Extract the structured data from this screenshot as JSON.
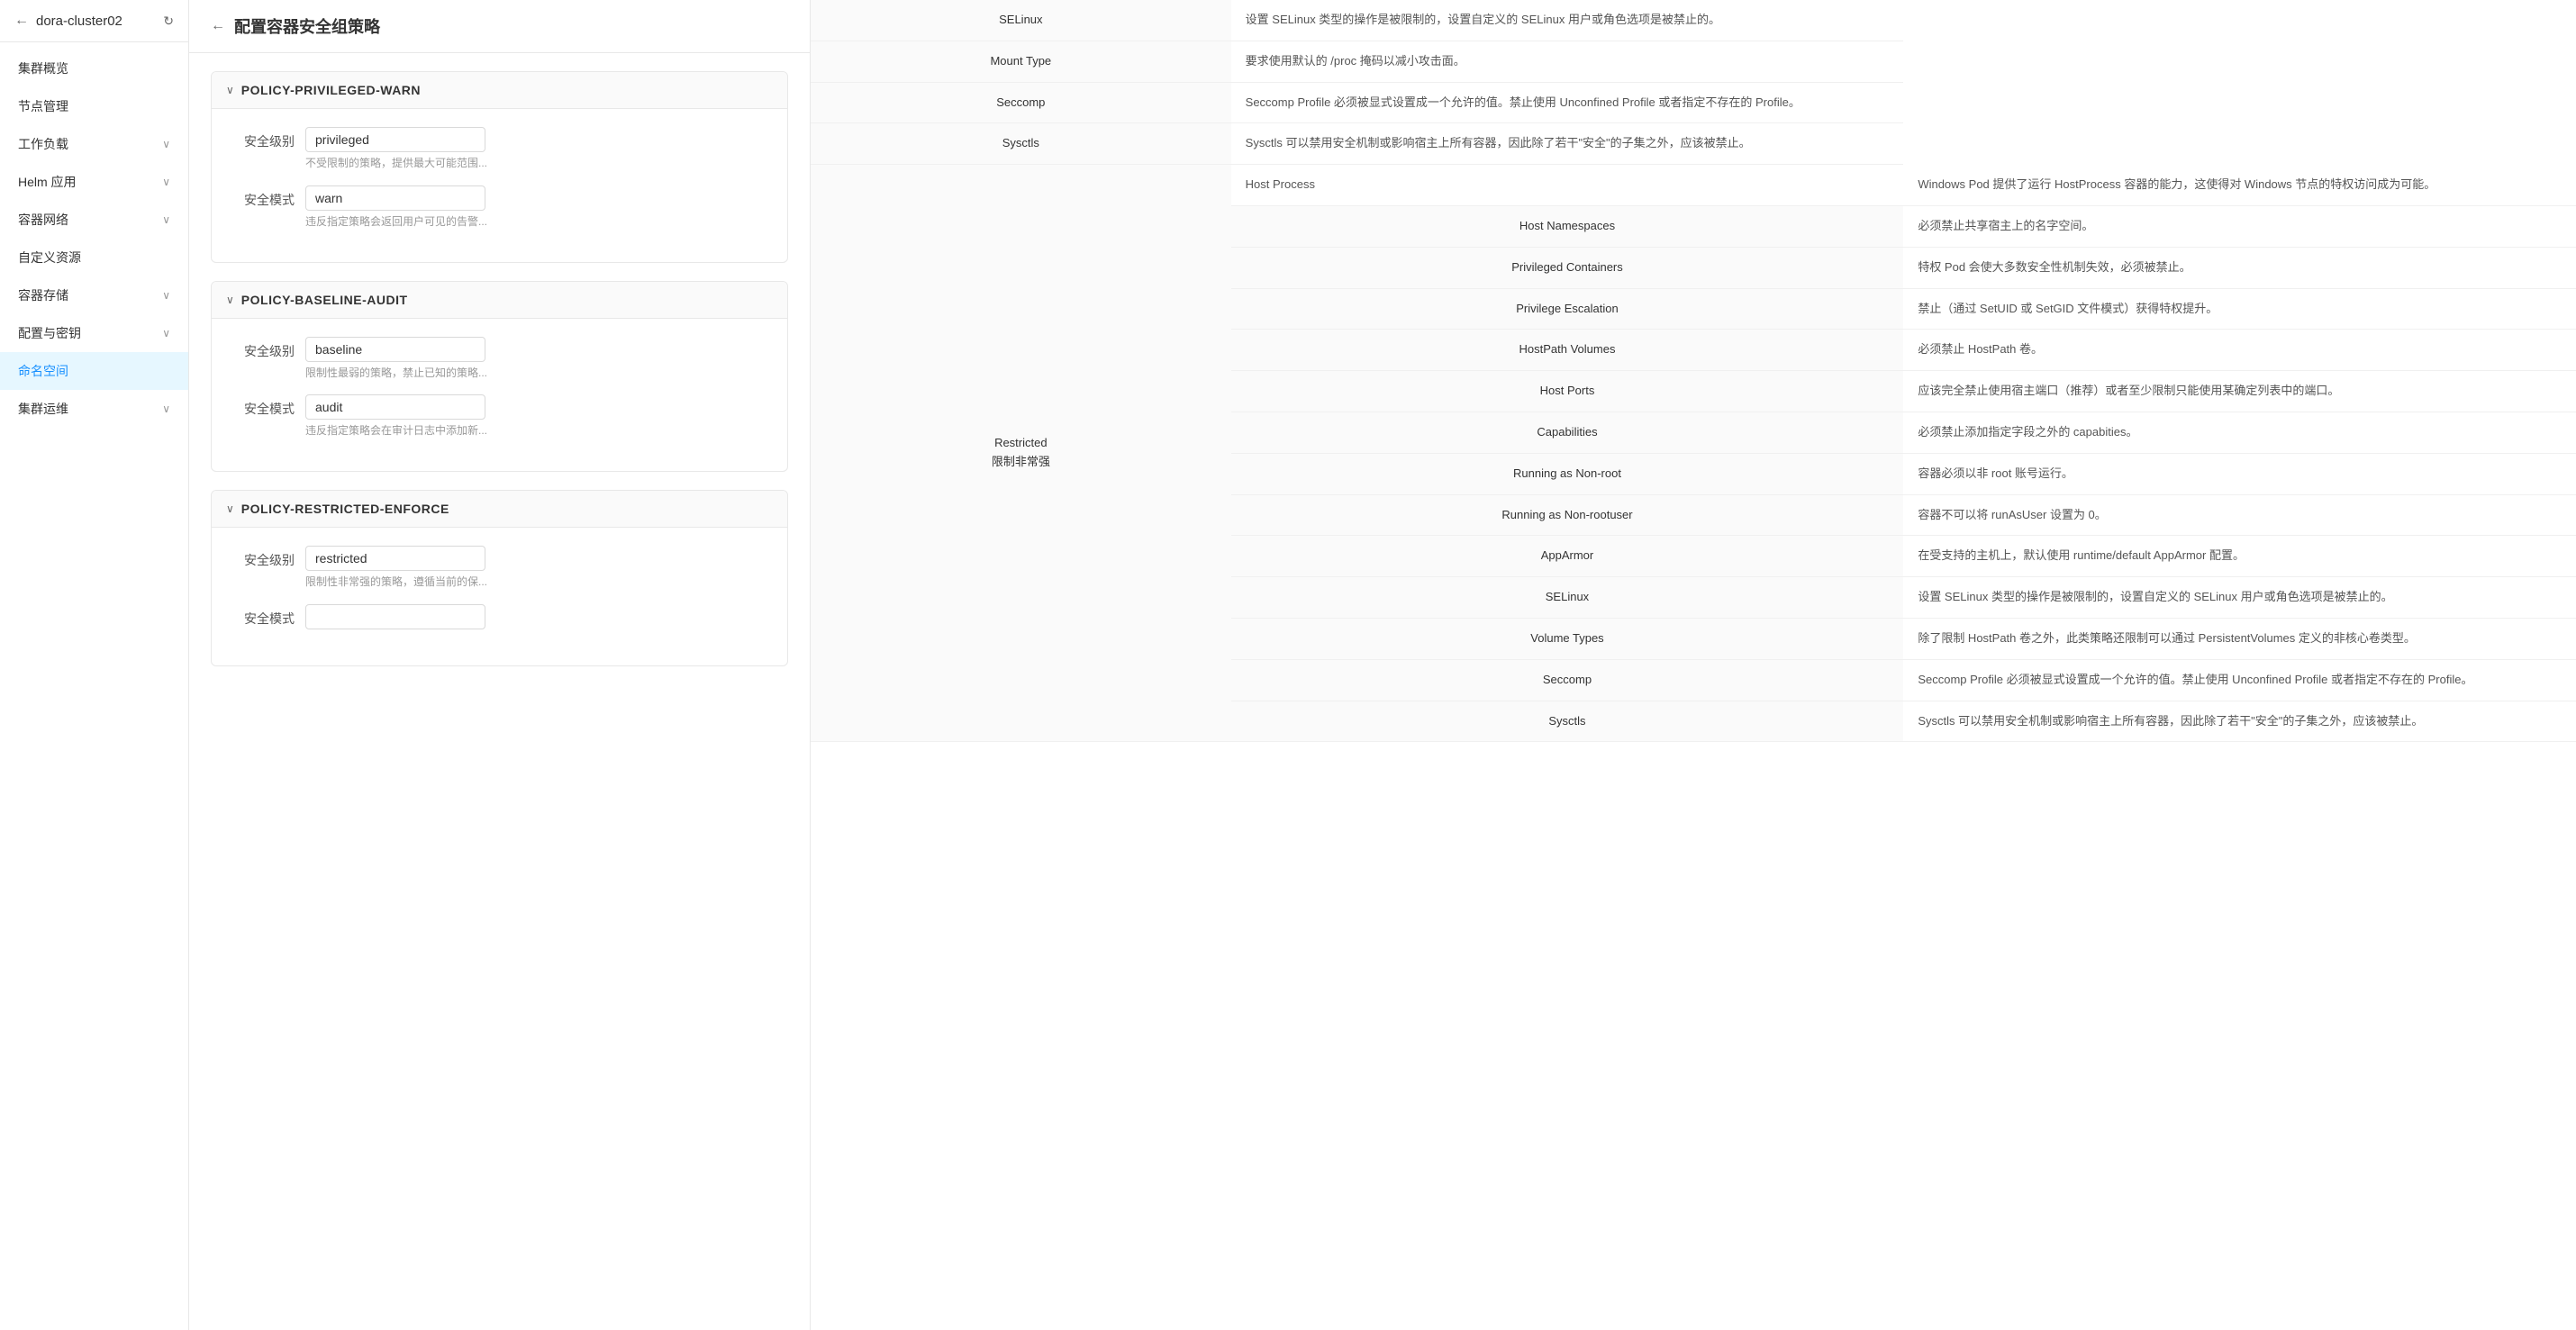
{
  "sidebar": {
    "cluster_name": "dora-cluster02",
    "nav_items": [
      {
        "id": "overview",
        "label": "集群概览",
        "has_children": false,
        "active": false
      },
      {
        "id": "nodes",
        "label": "节点管理",
        "has_children": false,
        "active": false
      },
      {
        "id": "workloads",
        "label": "工作负载",
        "has_children": true,
        "active": false
      },
      {
        "id": "helm",
        "label": "Helm 应用",
        "has_children": true,
        "active": false
      },
      {
        "id": "network",
        "label": "容器网络",
        "has_children": true,
        "active": false
      },
      {
        "id": "custom",
        "label": "自定义资源",
        "has_children": false,
        "active": false
      },
      {
        "id": "storage",
        "label": "容器存储",
        "has_children": true,
        "active": false
      },
      {
        "id": "config",
        "label": "配置与密钥",
        "has_children": true,
        "active": false
      },
      {
        "id": "namespace",
        "label": "命名空间",
        "has_children": false,
        "active": true
      },
      {
        "id": "ops",
        "label": "集群运维",
        "has_children": true,
        "active": false
      }
    ]
  },
  "left_panel": {
    "title": "配置容器安全组策略",
    "policies": [
      {
        "id": "privileged-warn",
        "name": "POLICY-PRIVILEGED-WARN",
        "security_level_label": "安全级别",
        "security_level_value": "privileged",
        "security_level_hint": "不受限制的策略，提供最大可能范围...",
        "security_mode_label": "安全模式",
        "security_mode_value": "warn",
        "security_mode_hint": "违反指定策略会返回用户可见的告警..."
      },
      {
        "id": "baseline-audit",
        "name": "POLICY-BASELINE-AUDIT",
        "security_level_label": "安全级别",
        "security_level_value": "baseline",
        "security_level_hint": "限制性最弱的策略，禁止已知的策略...",
        "security_mode_label": "安全模式",
        "security_mode_value": "audit",
        "security_mode_hint": "违反指定策略会在审计日志中添加新..."
      },
      {
        "id": "restricted-enforce",
        "name": "POLICY-RESTRICTED-ENFORCE",
        "security_level_label": "安全级别",
        "security_level_value": "restricted",
        "security_level_hint": "限制性非常强的策略，遵循当前的保...",
        "security_mode_label": "安全模式",
        "security_mode_value": "",
        "security_mode_hint": ""
      }
    ]
  },
  "right_panel": {
    "rows": [
      {
        "category": "",
        "field": "SELinux",
        "description": "设置 SELinux 类型的操作是被限制的，设置自定义的 SELinux 用户或角色选项是被禁止的。"
      },
      {
        "category": "",
        "field": "Mount Type",
        "description": "要求使用默认的 /proc 掩码以减小攻击面。"
      },
      {
        "category": "",
        "field": "Seccomp",
        "description": "Seccomp Profile 必须被显式设置成一个允许的值。禁止使用 Unconfined Profile 或者指定不存在的 Profile。"
      },
      {
        "category": "",
        "field": "Sysctls",
        "description": "Sysctls 可以禁用安全机制或影响宿主上所有容器，因此除了若干\"安全\"的子集之外，应该被禁止。"
      },
      {
        "category": "Restricted\n限制非常强",
        "field": "Host Process",
        "description": "Windows Pod 提供了运行 HostProcess 容器的能力，这使得对 Windows 节点的特权访问成为可能。"
      },
      {
        "category": "",
        "field": "Host Namespaces",
        "description": "必须禁止共享宿主上的名字空间。"
      },
      {
        "category": "",
        "field": "Privileged Containers",
        "description": "特权 Pod 会使大多数安全性机制失效，必须被禁止。"
      },
      {
        "category": "",
        "field": "Privilege Escalation",
        "description": "禁止（通过 SetUID 或 SetGID 文件模式）获得特权提升。"
      },
      {
        "category": "",
        "field": "HostPath Volumes",
        "description": "必须禁止 HostPath 卷。"
      },
      {
        "category": "",
        "field": "Host Ports",
        "description": "应该完全禁止使用宿主端口（推荐）或者至少限制只能使用某确定列表中的端口。"
      },
      {
        "category": "",
        "field": "Capabilities",
        "description": "必须禁止添加指定字段之外的 capabities。"
      },
      {
        "category": "",
        "field": "Running as Non-root",
        "description": "容器必须以非 root 账号运行。"
      },
      {
        "category": "",
        "field": "Running as Non-rootuser",
        "description": "容器不可以将 runAsUser 设置为 0。"
      },
      {
        "category": "",
        "field": "AppArmor",
        "description": "在受支持的主机上，默认使用 runtime/default AppArmor 配置。"
      },
      {
        "category": "",
        "field": "SELinux",
        "description": "设置 SELinux 类型的操作是被限制的，设置自定义的 SELinux 用户或角色选项是被禁止的。"
      },
      {
        "category": "",
        "field": "Volume Types",
        "description": "除了限制 HostPath 卷之外，此类策略还限制可以通过 PersistentVolumes 定义的非核心卷类型。"
      },
      {
        "category": "",
        "field": "Seccomp",
        "description": "Seccomp Profile 必须被显式设置成一个允许的值。禁止使用 Unconfined Profile 或者指定不存在的 Profile。"
      },
      {
        "category": "",
        "field": "Sysctls",
        "description": "Sysctls 可以禁用安全机制或影响宿主上所有容器，因此除了若干\"安全\"的子集之外，应该被禁止。"
      }
    ]
  }
}
